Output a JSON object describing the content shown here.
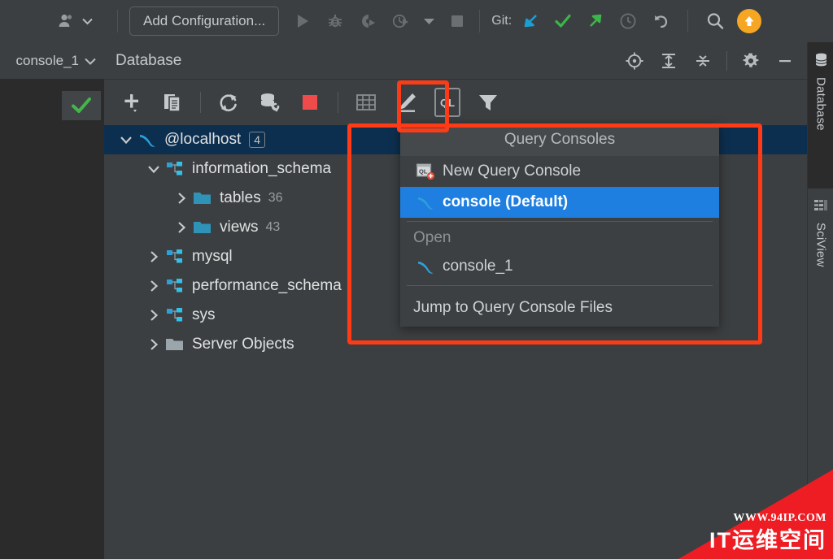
{
  "toolbar": {
    "avatar_icon": "user-avatar-icon",
    "avatar_dropdown_icon": "chevron-down-icon",
    "run_config_label": "Add Configuration...",
    "run_icon": "run-play-icon",
    "debug_icon": "debug-bug-icon",
    "coverage_icon": "run-with-coverage-icon",
    "profile_icon": "profiler-icon",
    "profile_dropdown_icon": "chevron-down-icon",
    "stop_icon": "stop-square-icon",
    "git_label": "Git:",
    "git_update_icon": "update-project-arrow-icon",
    "git_commit_icon": "commit-checkmark-icon",
    "git_push_icon": "push-arrow-icon",
    "history_icon": "clock-history-icon",
    "undo_icon": "undo-arrow-icon",
    "search_icon": "search-magnifier-icon",
    "update_badge_icon": "update-available-arrow-icon"
  },
  "editor_tabs": {
    "tab_label": "console_1",
    "tab_dropdown_icon": "chevron-down-icon",
    "status_icon": "green-checkmark-icon"
  },
  "database_panel": {
    "title": "Database",
    "header_icons": [
      {
        "name": "scroll-from-source-icon"
      },
      {
        "name": "expand-all-icon"
      },
      {
        "name": "collapse-all-icon"
      },
      {
        "name": "settings-gear-icon"
      },
      {
        "name": "minimize-panel-icon"
      }
    ],
    "toolbar_icons": [
      {
        "name": "add-data-source-icon"
      },
      {
        "name": "duplicate-icon"
      },
      {
        "name": "refresh-sync-icon"
      },
      {
        "name": "database-tools-icon"
      },
      {
        "name": "stop-red-square-icon"
      },
      {
        "name": "table-grid-icon"
      },
      {
        "name": "modify-pencil-icon"
      },
      {
        "name": "query-console-ql-icon",
        "label": "QL"
      },
      {
        "name": "filter-funnel-icon"
      }
    ],
    "tree": [
      {
        "label": "@localhost",
        "icon": "mysql-dolphin-icon",
        "indent": 0,
        "twisty": "expanded",
        "badge": "4",
        "selected": true
      },
      {
        "label": "information_schema",
        "icon": "schema-icon",
        "indent": 1,
        "twisty": "expanded"
      },
      {
        "label": "tables",
        "icon": "folder-icon",
        "indent": 2,
        "twisty": "collapsed",
        "count": "36"
      },
      {
        "label": "views",
        "icon": "folder-icon",
        "indent": 2,
        "twisty": "collapsed",
        "count": "43"
      },
      {
        "label": "mysql",
        "icon": "schema-icon",
        "indent": 1,
        "twisty": "collapsed"
      },
      {
        "label": "performance_schema",
        "icon": "schema-icon",
        "indent": 1,
        "twisty": "collapsed"
      },
      {
        "label": "sys",
        "icon": "schema-icon",
        "indent": 1,
        "twisty": "collapsed"
      },
      {
        "label": "Server Objects",
        "icon": "gray-folder-icon",
        "indent": 1,
        "twisty": "collapsed"
      }
    ]
  },
  "query_consoles_menu": {
    "header": "Query Consoles",
    "new_console": {
      "label": "New Query Console",
      "icon": "new-query-console-icon"
    },
    "default_console": {
      "label": "console (Default)",
      "icon": "mysql-console-icon"
    },
    "open_group_label": "Open",
    "open_items": [
      {
        "label": "console_1",
        "icon": "mysql-console-icon"
      }
    ],
    "jump_label": "Jump to Query Console Files"
  },
  "right_tool_window": {
    "tabs": [
      {
        "label": "Database",
        "icon": "database-cylinder-icon",
        "active": true
      },
      {
        "label": "SciView",
        "icon": "sciview-grid-icon",
        "active": false
      }
    ]
  },
  "watermark": {
    "url": "WWW.94IP.COM",
    "text": "IT运维空间"
  },
  "colors": {
    "accent_blue": "#1f7fe0",
    "annotation_red": "#ff3b17",
    "panel_bg": "#3c3f41",
    "editor_bg": "#2b2b2b",
    "selection_navy": "#0d2f4f",
    "icon_teal": "#3592c4",
    "green": "#49b84b",
    "orange": "#f5a623",
    "red_stop": "#f04b4b"
  }
}
